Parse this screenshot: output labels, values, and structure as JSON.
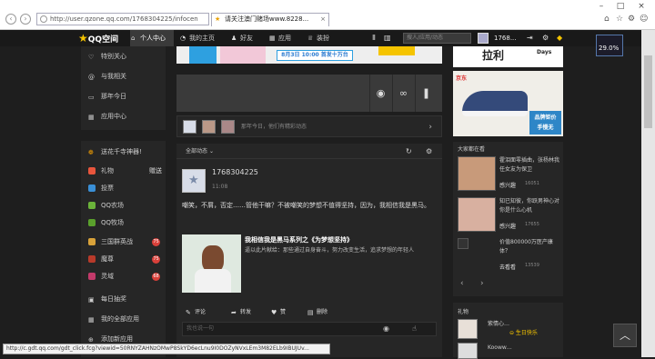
{
  "browser": {
    "url": "http://user.qzone.qq.com/1768304225/infocen",
    "tab_title": "请关注澳门赌场www.8228...",
    "back_glyph": "‹",
    "forward_glyph": "›",
    "close_tab_glyph": "×",
    "star_glyph": "★",
    "window_buttons": {
      "min": "–",
      "max": "□",
      "close": "×"
    },
    "toolbar_icons": {
      "home": "⌂",
      "star": "☆",
      "gear": "⚙",
      "smile": "☺"
    }
  },
  "topbar": {
    "logo": "QQ空间",
    "nav": [
      {
        "label": "个人中心",
        "icon": "⌂"
      },
      {
        "label": "我的主页",
        "icon": "◔"
      },
      {
        "label": "好友",
        "icon": "♟"
      },
      {
        "label": "应用",
        "icon": "▦"
      },
      {
        "label": "装扮",
        "icon": "♕"
      }
    ],
    "search_placeholder": "搜人/应用/动态",
    "user_id": "1768...",
    "icons": {
      "mute": "Ⅱ",
      "chart": "▥",
      "logout": "⇥",
      "gear": "⚙",
      "diamond": "◆"
    }
  },
  "sidebar": {
    "top_items": [
      {
        "label": "特别关心",
        "icon": "♡"
      },
      {
        "label": "与我相关",
        "icon": "@"
      },
      {
        "label": "那年今日",
        "icon": "▭"
      },
      {
        "label": "应用中心",
        "icon": "▦"
      }
    ],
    "promo": {
      "label": "送花千寺神器!",
      "icon": "❁"
    },
    "apps": [
      {
        "label": "礼物",
        "tag": "赠送",
        "color": "#e8553c"
      },
      {
        "label": "投票",
        "tag": "",
        "color": "#3a8fd6"
      },
      {
        "label": "QQ农场",
        "tag": "",
        "color": "#6bb33a"
      },
      {
        "label": "QQ牧场",
        "tag": "",
        "color": "#5aa02c"
      },
      {
        "label": "三国群英战",
        "tag": "75",
        "color": "#d8a23a"
      },
      {
        "label": "魔尊",
        "tag": "75",
        "color": "#b83a2a"
      },
      {
        "label": "灵域",
        "tag": "68",
        "color": "#c33a6a"
      }
    ],
    "bottom_items": [
      {
        "label": "每日抽奖",
        "icon": "▣"
      },
      {
        "label": "我的全部应用",
        "icon": "▦"
      },
      {
        "label": "添加新应用",
        "icon": "⊕"
      }
    ]
  },
  "main": {
    "ad_date": "8月3日 10:00 首发十万台",
    "composer_icons": [
      "◉",
      "∞",
      "❚"
    ],
    "friend_hint": "那年今日，他们有精彩动态",
    "friend_arrow": "›",
    "feed_filter": "全部动态",
    "feed_filter_chevron": "⌄",
    "refresh_icon": "↻",
    "settings_icon": "⚙",
    "post": {
      "user": "1768304225",
      "time": "11:08",
      "text": "嘲笑，不屑，否定……管他干嘛？不被嘲笑的梦想不值得坚持，因为，我相信我是黑马。",
      "share_title": "我相信我是黑马系列之《为梦想坚持》",
      "share_desc": "逼以此片献给：那些通过自身奋斗，努力改变生活，追求梦想的年轻人",
      "actions": [
        {
          "label": "评论",
          "icon": "✎"
        },
        {
          "label": "转发",
          "icon": "➦"
        },
        {
          "label": "赞",
          "icon": "♥"
        },
        {
          "label": "删除",
          "icon": "▤"
        }
      ],
      "comment_placeholder": "我也说一句",
      "comment_icons": [
        "◉",
        "☝"
      ]
    }
  },
  "right": {
    "ad_top_text": "拉利",
    "ad_days": "Days",
    "ad_shoe_brand": "京东",
    "ad_shoe_promo": [
      "品牌钜价",
      "手慢无"
    ],
    "watching_title": "大家都在看",
    "videos": [
      {
        "title": "霍泪面零插曲，张杨林我任女友为保卫",
        "meta": "感兴趣",
        "count": "16051",
        "thumb": "#c89a7a"
      },
      {
        "title": "知已知彼，你跃男神心对你是什么心机",
        "meta": "感兴趣",
        "count": "17655",
        "thumb": "#d8b0a0"
      },
      {
        "title": "价值800000万医产康体？",
        "meta": "去看看",
        "count": "13539",
        "thumb": "#333"
      }
    ],
    "pager": [
      "‹",
      "›"
    ],
    "gifts_title": "礼物",
    "gift_user": "紫情心…",
    "gift_tag": "⊖ 生日快乐",
    "gift_user2": "Kooww…"
  },
  "overlay": {
    "perf_value": "29.0%",
    "to_top": "︿",
    "status_url": "http://c.gdt.qq.com/gdt_click.fcg?viewid=50RNYZAHNzOMwP8SkYD6ecLnu9I0DOZyNVxLEm3M82ELb9IBUJUv..."
  }
}
